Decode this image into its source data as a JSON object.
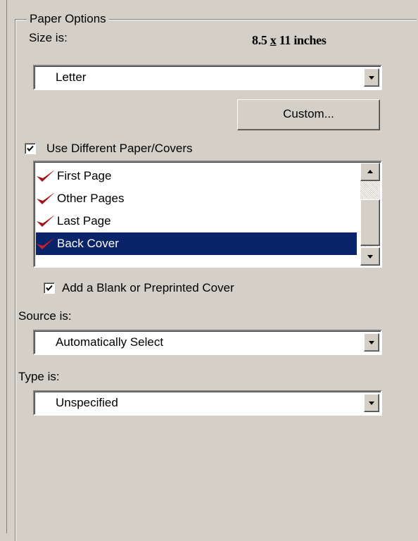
{
  "paper_options": {
    "group_title": "Paper Options",
    "size_label": "Size is:",
    "size_value": {
      "width": "8.5",
      "x": "x",
      "height": "11",
      "unit": "inches"
    },
    "size_select": {
      "value": "Letter"
    },
    "custom_button": "Custom...",
    "use_different_paper": {
      "label": "Use Different Paper/Covers",
      "checked": true
    },
    "pages_list": {
      "items": [
        {
          "label": "First Page",
          "checked": true,
          "selected": false
        },
        {
          "label": "Other Pages",
          "checked": true,
          "selected": false
        },
        {
          "label": "Last Page",
          "checked": true,
          "selected": false
        },
        {
          "label": "Back Cover",
          "checked": true,
          "selected": true
        }
      ]
    },
    "add_blank_cover": {
      "label": "Add a Blank or Preprinted Cover",
      "checked": true
    },
    "source_label": "Source is:",
    "source_select": {
      "value": "Automatically Select"
    },
    "type_label": "Type is:",
    "type_select": {
      "value": "Unspecified"
    }
  },
  "colors": {
    "dialog_bg": "#d4d0c8",
    "selection_bg": "#0a246a",
    "check_red": "#a4121a"
  }
}
